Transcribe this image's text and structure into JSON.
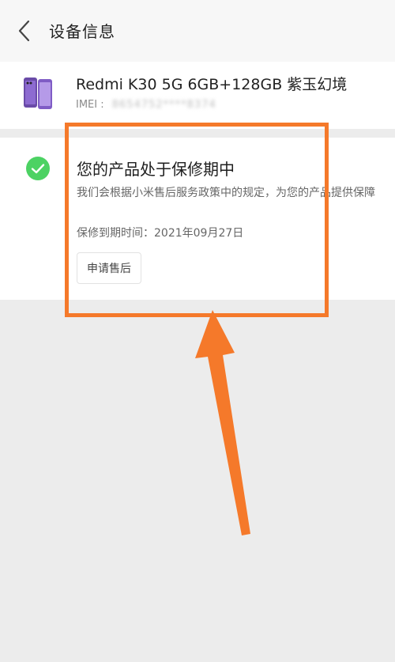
{
  "header": {
    "title": "设备信息",
    "back_icon": "chevron-left-icon"
  },
  "device": {
    "name": "Redmi K30 5G  6GB+128GB  紫玉幻境",
    "imei_label": "IMEI :",
    "imei_value_obscured": "8654752****8374",
    "thumbnail_icon": "phone-thumbnail"
  },
  "warranty": {
    "status_icon": "check-circle-icon",
    "status_color": "#4cd263",
    "title": "您的产品处于保修期中",
    "description": "我们会根据小米售后服务政策中的规定，为您的产品提供保障",
    "expiry": "保修到期时间：2021年09月27日",
    "service_button": "申请售后"
  },
  "annotation": {
    "color": "#f5792a"
  }
}
